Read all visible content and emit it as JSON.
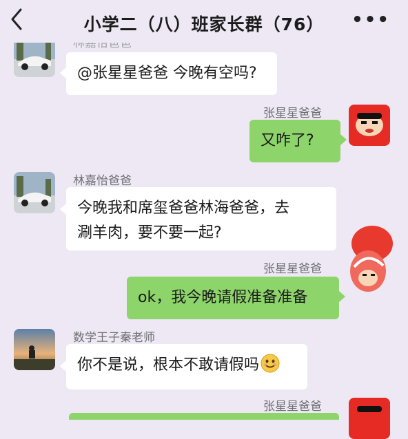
{
  "header": {
    "title": "小学二（八）班家长群（76）",
    "more": "•••"
  },
  "messages": [
    {
      "sender": "林嘉怡爸爸",
      "text": "@张星星爸爸 今晚有空吗?"
    },
    {
      "sender": "张星星爸爸",
      "text": "又咋了?"
    },
    {
      "sender": "林嘉怡爸爸",
      "line1": "今晚我和席玺爸爸林海爸爸，去",
      "line2": "涮羊肉，要不要一起?"
    },
    {
      "sender": "张星星爸爸",
      "text": "ok，我今晚请假准备准备"
    },
    {
      "sender": "数学王子秦老师",
      "text": "你不是说，根本不敢请假吗",
      "emoji": "smiling-face-emoji"
    },
    {
      "sender": "张星星爸爸"
    }
  ]
}
